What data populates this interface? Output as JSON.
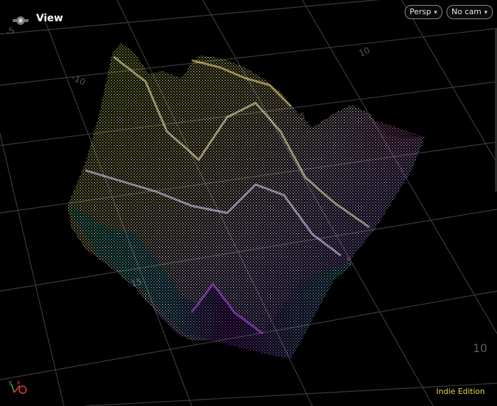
{
  "viewport": {
    "title": "View",
    "projection_menu": {
      "label": "Persp",
      "caret": "▾"
    },
    "camera_menu": {
      "label": "No cam",
      "caret": "▾"
    },
    "edition_label": "Indie Edition",
    "axis_labels": {
      "y": "y",
      "x": "x"
    },
    "grid_labels": [
      "-10",
      "10",
      "5",
      "-5",
      "5",
      "10",
      "15"
    ],
    "colors": {
      "background": "#000000",
      "grid": "#3a3a3a",
      "grid_label": "#5a5a5a",
      "edition": "#e8d44a"
    },
    "surface_colors": [
      "#b6e03a",
      "#f2e07a",
      "#ff8fe0",
      "#d08cff",
      "#6fe8ff",
      "#9a2fd8"
    ]
  }
}
